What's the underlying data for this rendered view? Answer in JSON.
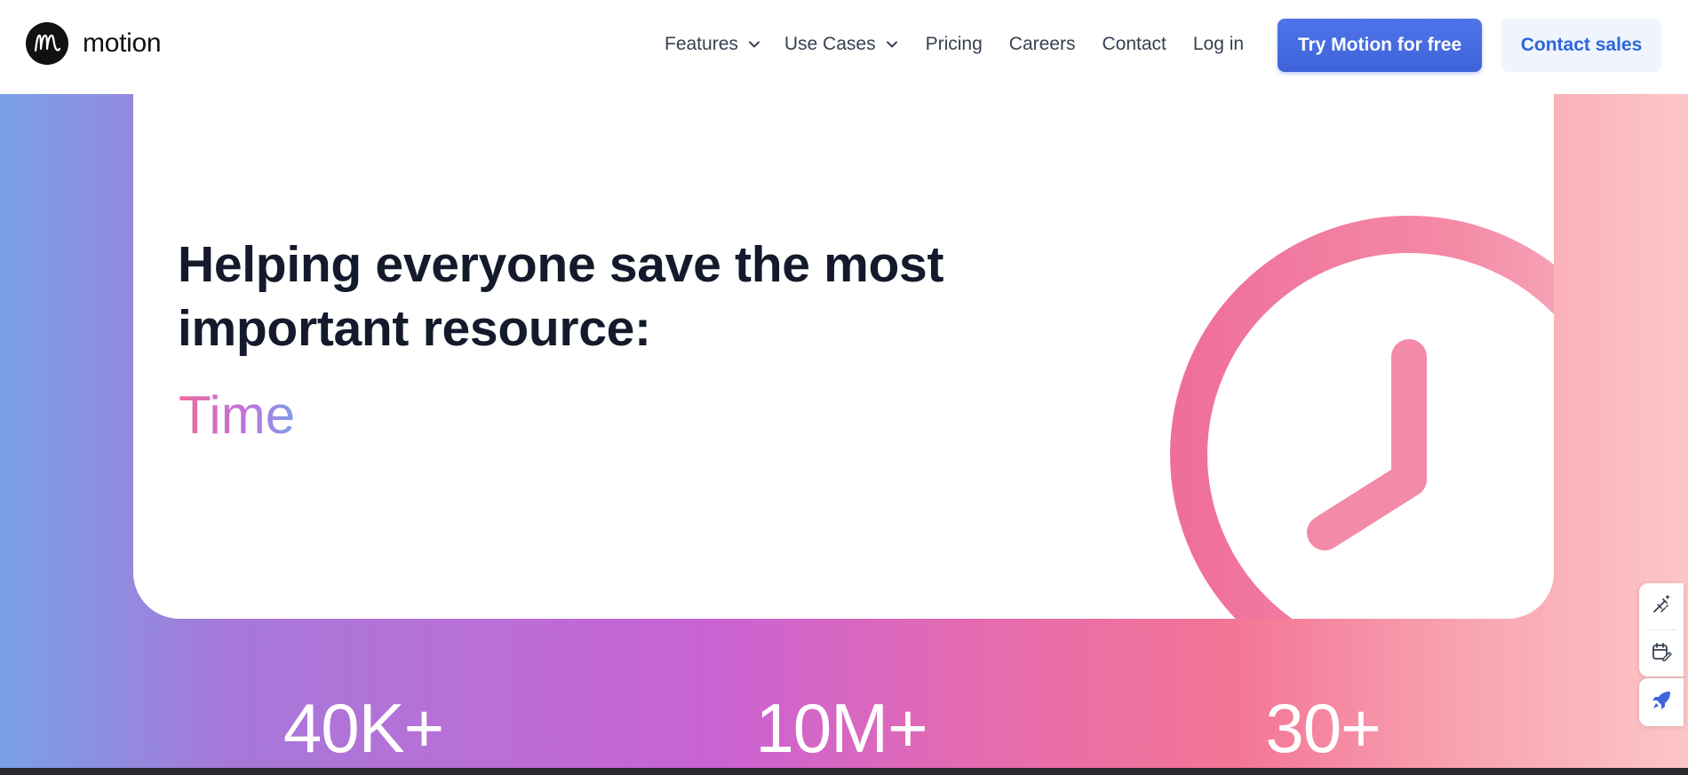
{
  "nav": {
    "logo_text": "motion",
    "links": [
      {
        "label": "Features",
        "dropdown": true
      },
      {
        "label": "Use Cases",
        "dropdown": true
      },
      {
        "label": "Pricing"
      },
      {
        "label": "Careers"
      },
      {
        "label": "Contact"
      },
      {
        "label": "Log in"
      }
    ],
    "cta_primary": "Try Motion for free",
    "cta_secondary": "Contact sales"
  },
  "hero": {
    "headline_line1": "Helping everyone save the most",
    "headline_line2": "important resource:",
    "highlight_word": "Time"
  },
  "stats": [
    {
      "value": "40K+"
    },
    {
      "value": "10M+"
    },
    {
      "value": "30+"
    }
  ],
  "side_tools": [
    {
      "icon": "magic-wand-icon"
    },
    {
      "icon": "calendar-edit-icon"
    },
    {
      "icon": "rocket-icon"
    }
  ],
  "colors": {
    "primary_button": "#3f63d9",
    "secondary_button_bg": "#eff4fd",
    "secondary_button_text": "#2f66d8",
    "clock": "#f07a9c",
    "headline": "#141a2c"
  }
}
